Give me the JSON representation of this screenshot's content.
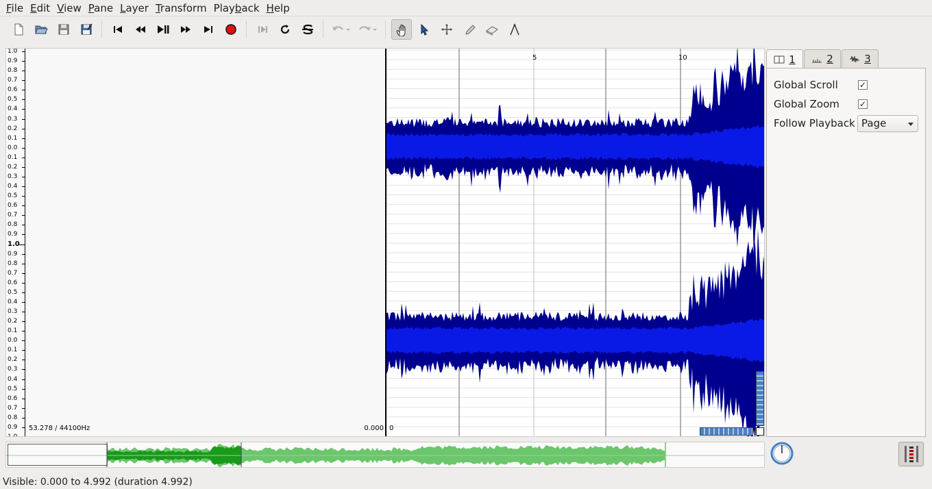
{
  "menu": [
    {
      "label": "File",
      "u": "F",
      "rest": "ile"
    },
    {
      "label": "Edit",
      "u": "E",
      "rest": "dit"
    },
    {
      "label": "View",
      "u": "V",
      "rest": "iew"
    },
    {
      "label": "Pane",
      "u": "P",
      "rest": "ane"
    },
    {
      "label": "Layer",
      "u": "L",
      "rest": "ayer"
    },
    {
      "label": "Transform",
      "u": "T",
      "rest": "ransform"
    },
    {
      "label": "Playback",
      "pre": "Play",
      "u": "b",
      "rest": "ack"
    },
    {
      "label": "Help",
      "u": "H",
      "rest": "elp"
    }
  ],
  "toolbar": {
    "icons": [
      "new-file-icon",
      "open-folder-icon",
      "save-icon",
      "save-as-icon",
      "rewind-start-icon",
      "rewind-icon",
      "play-pause-icon",
      "fast-forward-icon",
      "fast-forward-end-icon",
      "record-icon",
      "play-selection-icon",
      "loop-icon",
      "solo-icon",
      "undo-icon",
      "redo-icon",
      "navigate-hand-icon",
      "select-arrow-icon",
      "move-cross-icon",
      "draw-pencil-icon",
      "erase-icon",
      "measure-icon"
    ]
  },
  "scale": {
    "top_channel": [
      "1.0",
      "0.9",
      "0.8",
      "0.7",
      "0.6",
      "0.5",
      "0.4",
      "0.3",
      "0.2",
      "0.1",
      "0.0",
      "0.1",
      "0.2",
      "0.3",
      "0.4",
      "0.5",
      "0.6",
      "0.7",
      "0.8",
      "0.9"
    ],
    "mid": "1.0",
    "bottom_channel": [
      "0.9",
      "0.8",
      "0.7",
      "0.6",
      "0.5",
      "0.4",
      "0.3",
      "0.2",
      "0.1",
      "0.0",
      "0.1",
      "0.2",
      "0.3",
      "0.4",
      "0.5",
      "0.6",
      "0.7",
      "0.8",
      "0.9",
      "1.0"
    ]
  },
  "pane": {
    "sample_rate_info": "53.278 / 44100Hz",
    "left_time": "0.000",
    "right_time": "0",
    "ruler_labels": [
      "5",
      "10"
    ]
  },
  "properties": {
    "tabs": [
      {
        "num": "1",
        "icon": "pane-icon"
      },
      {
        "num": "2",
        "icon": "ruler-icon"
      },
      {
        "num": "3",
        "icon": "waveform-icon"
      }
    ],
    "global_scroll_label": "Global Scroll",
    "global_scroll_checked": true,
    "global_zoom_label": "Global Zoom",
    "global_zoom_checked": true,
    "follow_playback_label": "Follow Playback",
    "follow_playback_value": "Page"
  },
  "status": {
    "text": "Visible: 0.000 to 4.992 (duration 4.992)"
  },
  "colors": {
    "wave_dark": "#00008f",
    "wave_light": "#0a1ae6",
    "overview_dark": "#1a9a1a",
    "overview_light": "#6cc66c"
  }
}
